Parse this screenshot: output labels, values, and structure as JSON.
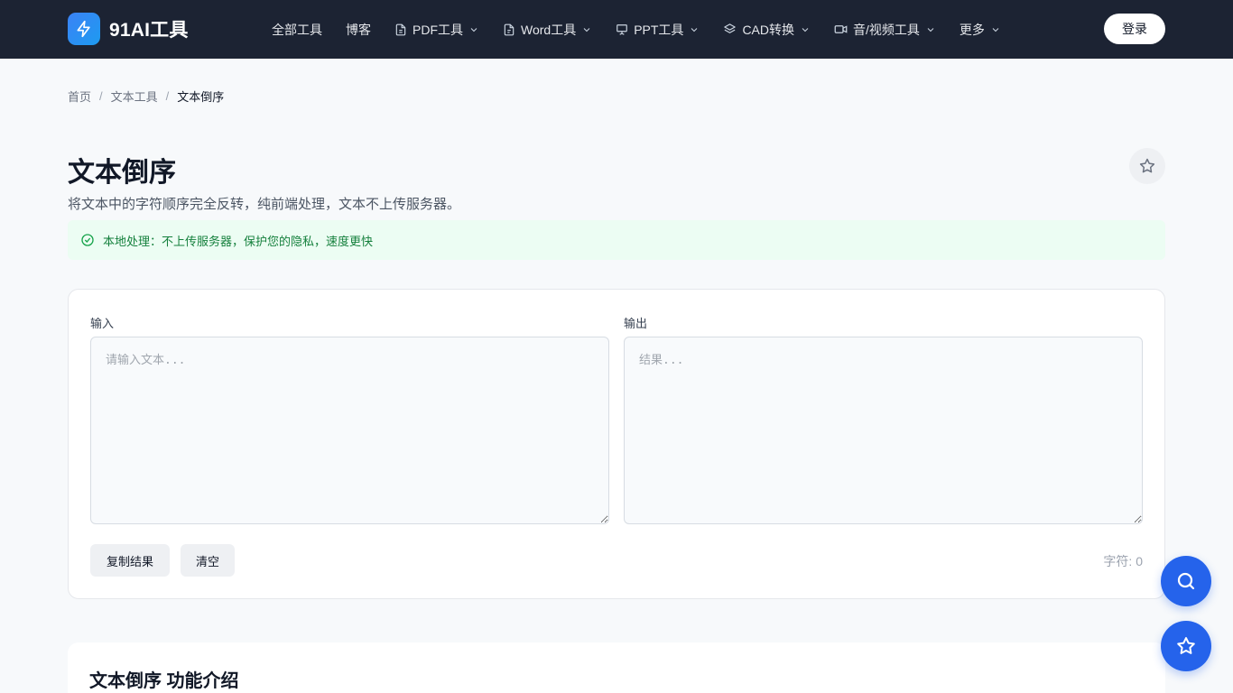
{
  "header": {
    "logo_text": "91AI工具",
    "nav": [
      {
        "label": "全部工具",
        "icon": "",
        "dropdown": false
      },
      {
        "label": "博客",
        "icon": "",
        "dropdown": false
      },
      {
        "label": "PDF工具",
        "icon": "file-icon",
        "dropdown": true
      },
      {
        "label": "Word工具",
        "icon": "file-text-icon",
        "dropdown": true
      },
      {
        "label": "PPT工具",
        "icon": "presentation-icon",
        "dropdown": true
      },
      {
        "label": "CAD转换",
        "icon": "layers-icon",
        "dropdown": true
      },
      {
        "label": "音/视频工具",
        "icon": "video-icon",
        "dropdown": true
      },
      {
        "label": "更多",
        "icon": "",
        "dropdown": true
      }
    ],
    "login_label": "登录"
  },
  "breadcrumb": {
    "items": [
      "首页",
      "文本工具"
    ],
    "current": "文本倒序",
    "separator": "/"
  },
  "page": {
    "title": "文本倒序",
    "description": "将文本中的字符顺序完全反转，纯前端处理，文本不上传服务器。",
    "notice": "本地处理：不上传服务器，保护您的隐私，速度更快"
  },
  "tool": {
    "input_label": "输入",
    "input_placeholder": "请输入文本...",
    "input_value": "",
    "output_label": "输出",
    "output_placeholder": "结果...",
    "output_value": "",
    "copy_label": "复制结果",
    "clear_label": "清空",
    "char_count": "字符: 0"
  },
  "intro": {
    "title": "文本倒序 功能介绍"
  },
  "colors": {
    "header_bg": "#1c2333",
    "accent": "#2563eb",
    "notice_bg": "#ecfdf3",
    "notice_text": "#15803d"
  }
}
